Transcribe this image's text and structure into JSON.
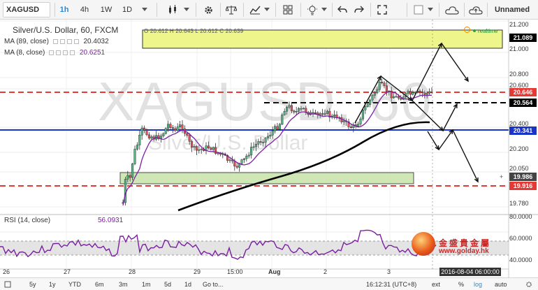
{
  "toolbar": {
    "symbol": "XAGUSD",
    "intervals": [
      "1h",
      "4h",
      "1W",
      "1D"
    ],
    "active_interval": "1h",
    "layout_name": "Unnamed"
  },
  "chart": {
    "title": "Silver/U.S. Dollar, 60, FXCM",
    "ohlc": "O 20.612  H 20.643  L 20.612  C 20.639",
    "realtime": "realtime",
    "ma1_label": "MA (89, close)",
    "ma1_value": "20.4032",
    "ma2_label": "MA (8, close)",
    "ma2_value": "20.6251",
    "rsi_label": "RSI (14, close)",
    "rsi_value": "56.0931",
    "watermark_symbol": "XAGUSD, 60",
    "watermark_name": "Silver/U.S. Dollar"
  },
  "price_axis": {
    "ticks": [
      "21.200",
      "21.000",
      "20.800",
      "20.600",
      "20.400",
      "20.200",
      "20.050",
      "19.780"
    ],
    "tags": [
      {
        "label": "21.089",
        "color": "#000000"
      },
      {
        "label": "20.646",
        "color": "#e53935"
      },
      {
        "label": "20.564",
        "color": "#000000"
      },
      {
        "label": "20.341",
        "color": "#1a33c9"
      },
      {
        "label": "19.986",
        "color": "#444444"
      },
      {
        "label": "19.916",
        "color": "#e53935"
      }
    ],
    "rsi_ticks": [
      "80.0000",
      "60.0000",
      "40.0000"
    ]
  },
  "time_axis": {
    "labels": [
      "26",
      "27",
      "28",
      "29",
      "15:00",
      "Aug",
      "2",
      "3"
    ],
    "crosshair_time": "2016-08-04 06:00:00"
  },
  "bottom_bar": {
    "ranges": [
      "5d",
      "5y",
      "1y",
      "YTD",
      "6m",
      "3m",
      "1m",
      "5d",
      "1d",
      "Go to..."
    ],
    "clock": "16:12:31 (UTC+8)",
    "options": [
      "ext",
      "%",
      "log",
      "auto"
    ]
  },
  "logo": {
    "chinese": "金盛貴金屬",
    "url": "www.golday.hk"
  },
  "colors": {
    "up": "#53b987",
    "down": "#eb4d5c",
    "ma_long": "#000000",
    "ma_short": "#7b1fa2",
    "support": "#1a33c9",
    "resistance": "#e53935",
    "zone": "#eef58a"
  }
}
